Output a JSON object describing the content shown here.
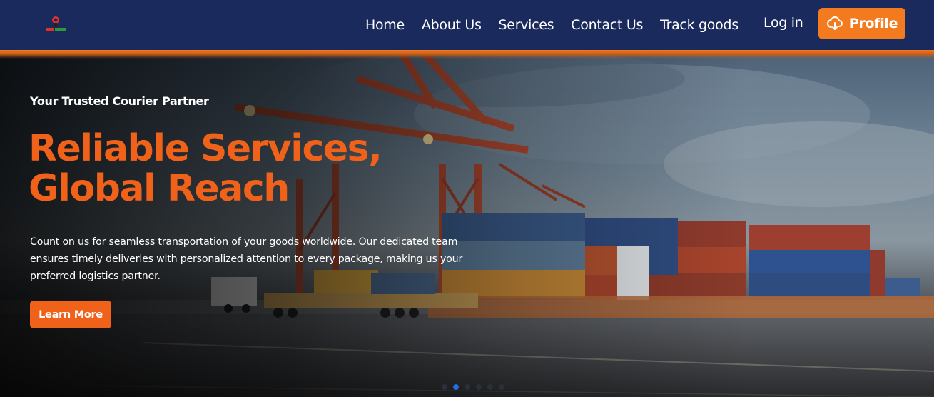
{
  "nav": {
    "links": [
      "Home",
      "About Us",
      "Services",
      "Contact Us",
      "Track goods"
    ],
    "login_label": "Log in",
    "profile_label": "Profile",
    "profile_icon": "cloud-download-icon"
  },
  "hero": {
    "tagline": "Your Trusted Courier Partner",
    "headline_line1": "Reliable Services,",
    "headline_line2": "Global Reach",
    "description": "Count on us for seamless transportation of your goods worldwide. Our dedicated team ensures timely deliveries with personalized attention to every package, making us your preferred logistics partner.",
    "cta_label": "Learn More"
  },
  "carousel": {
    "slide_count": 6,
    "active_index": 1
  },
  "colors": {
    "navbar_bg": "#1b2a5c",
    "accent_orange": "#f47a20",
    "headline_orange": "#f0611a",
    "active_dot": "#1d6fe0"
  }
}
